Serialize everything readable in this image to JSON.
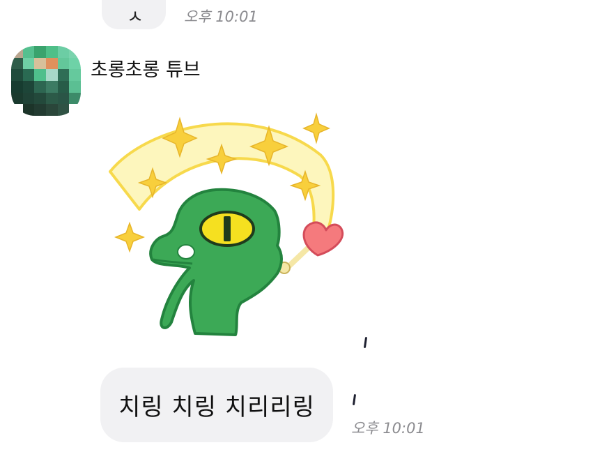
{
  "previous_message": {
    "partial_text": "ㅅ",
    "time": "오후 10:01"
  },
  "sender": {
    "name": "초롱초롱 튜브",
    "avatar_icon": "pixelated-profile-avatar-icon",
    "avatar_colors": [
      "#b9a58f",
      "#55c08f",
      "#3aa36d",
      "#4fbf88",
      "#6ccda4",
      "#7ad3ad",
      "#2e5d49",
      "#6fd0a5",
      "#d8c09a",
      "#e0905d",
      "#63c79a",
      "#6ed2a7",
      "#1f4b3b",
      "#2a6a52",
      "#4fbf8c",
      "#a7d8c8",
      "#2f6e56",
      "#65c99d",
      "#173c30",
      "#1d4538",
      "#2d6651",
      "#3c7b63",
      "#275c48",
      "#5bbf93",
      "#1a3a2e",
      "#1f4236",
      "#23493b",
      "#2c5a48",
      "#2a5546",
      "#3c8b69",
      "#ffffff",
      "#1c3429",
      "#223b31",
      "#2a463a",
      "#2f5244",
      "#ffffff"
    ]
  },
  "sticker": {
    "icon": "green-creature-magic-wand-sticker",
    "colors": {
      "body": "#3ca956",
      "outline": "#23833e",
      "eye": "#f5e020",
      "arc": "#fdf6bd",
      "arc_edge": "#f7d94c",
      "sparkle": "#f8cf3c",
      "heart": "#f57a7d"
    }
  },
  "message": {
    "text": "치링 치링 치리리링",
    "time": "오후 10:01"
  },
  "colors": {
    "bubble": "#f1f1f3",
    "time_text": "#8b8b8f"
  }
}
